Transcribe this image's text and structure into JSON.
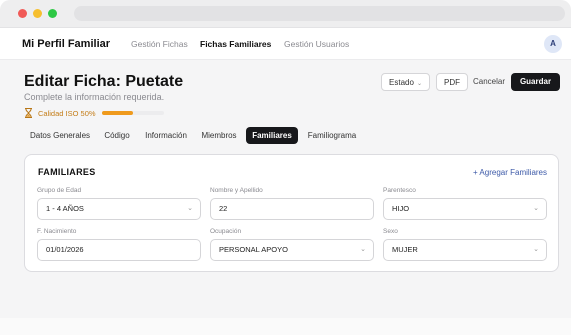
{
  "navbar": {
    "brand": "Mi Perfil Familiar",
    "links": [
      "Gestión Fichas",
      "Fichas Familiares",
      "Gestión Usuarios"
    ],
    "active_link": "Fichas Familiares",
    "avatar_initial": "A"
  },
  "header": {
    "title": "Editar Ficha: Puetate",
    "subtitle": "Complete la información requerida.",
    "quality_label": "Calidad ISO 50%",
    "quality_progress": 0.5
  },
  "actions": {
    "estado_label": "Estado",
    "pdf_label": "PDF",
    "cancel_label": "Cancelar",
    "save_label": "Guardar"
  },
  "tabs": [
    {
      "label": "Datos Generales",
      "active": false
    },
    {
      "label": "Código",
      "active": false
    },
    {
      "label": "Información",
      "active": false
    },
    {
      "label": "Miembros",
      "active": false
    },
    {
      "label": "Familiares",
      "active": true
    },
    {
      "label": "Familiograma",
      "active": false
    }
  ],
  "card": {
    "title": "FAMILIARES",
    "add_label": "+ Agregar Familiares",
    "fields": [
      {
        "label": "Grupo de Edad",
        "value": "1 - 4 AÑOS",
        "type": "select"
      },
      {
        "label": "Nombre y Apellido",
        "value": "22",
        "type": "text"
      },
      {
        "label": "Parentesco",
        "value": "HIJO",
        "type": "select"
      },
      {
        "label": "F. Nacimiento",
        "value": "01/01/2026",
        "type": "date"
      },
      {
        "label": "Ocupación",
        "value": "PERSONAL APOYO",
        "type": "select"
      },
      {
        "label": "Sexo",
        "value": "MUJER",
        "type": "select"
      }
    ]
  },
  "colors": {
    "accent_dark": "#17181b",
    "quality_orange": "#ef9a1d",
    "link_blue": "#3d5aa8"
  }
}
